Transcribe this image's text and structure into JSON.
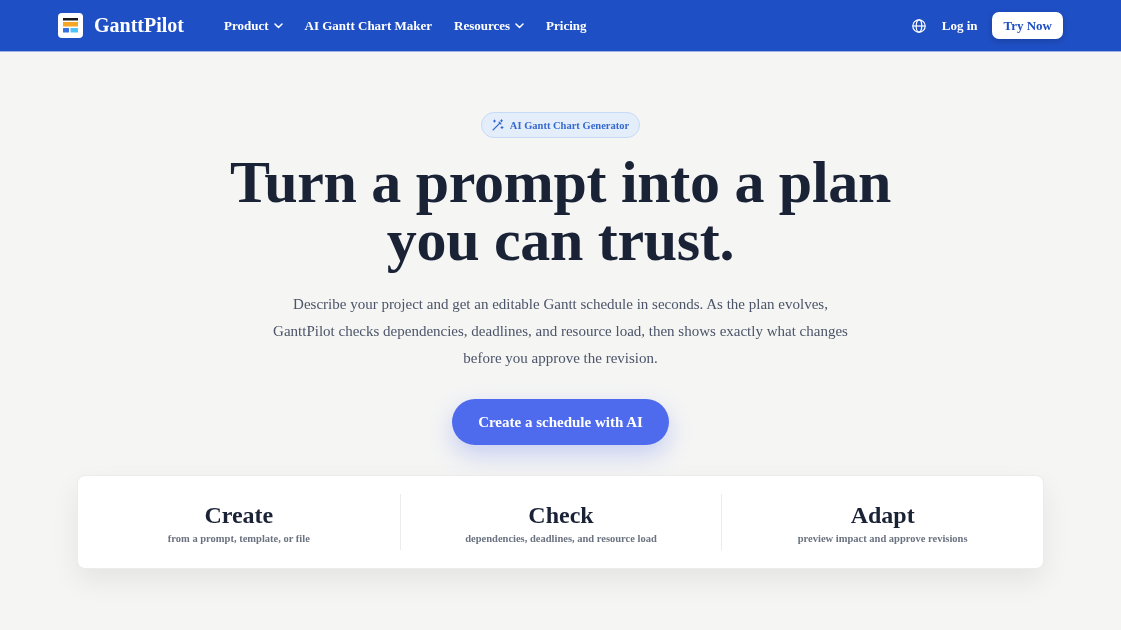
{
  "header": {
    "brand": "GanttPilot",
    "nav": [
      {
        "label": "Product",
        "dropdown": true
      },
      {
        "label": "AI Gantt Chart Maker",
        "dropdown": false
      },
      {
        "label": "Resources",
        "dropdown": true
      },
      {
        "label": "Pricing",
        "dropdown": false
      }
    ],
    "login": "Log in",
    "cta": "Try Now"
  },
  "hero": {
    "badge": "AI Gantt Chart Generator",
    "title_lines": [
      "Turn a prompt into a plan",
      "you can trust."
    ],
    "description": "Describe your project and get an editable Gantt schedule in seconds. As the plan evolves, GanttPilot checks dependencies, deadlines, and resource load, then shows exactly what changes before you approve the revision.",
    "cta": "Create a schedule with AI"
  },
  "features": [
    {
      "title": "Create",
      "subtitle": "from a prompt, template, or file"
    },
    {
      "title": "Check",
      "subtitle": "dependencies, deadlines, and resource load"
    },
    {
      "title": "Adapt",
      "subtitle": "preview impact and approve revisions"
    }
  ]
}
